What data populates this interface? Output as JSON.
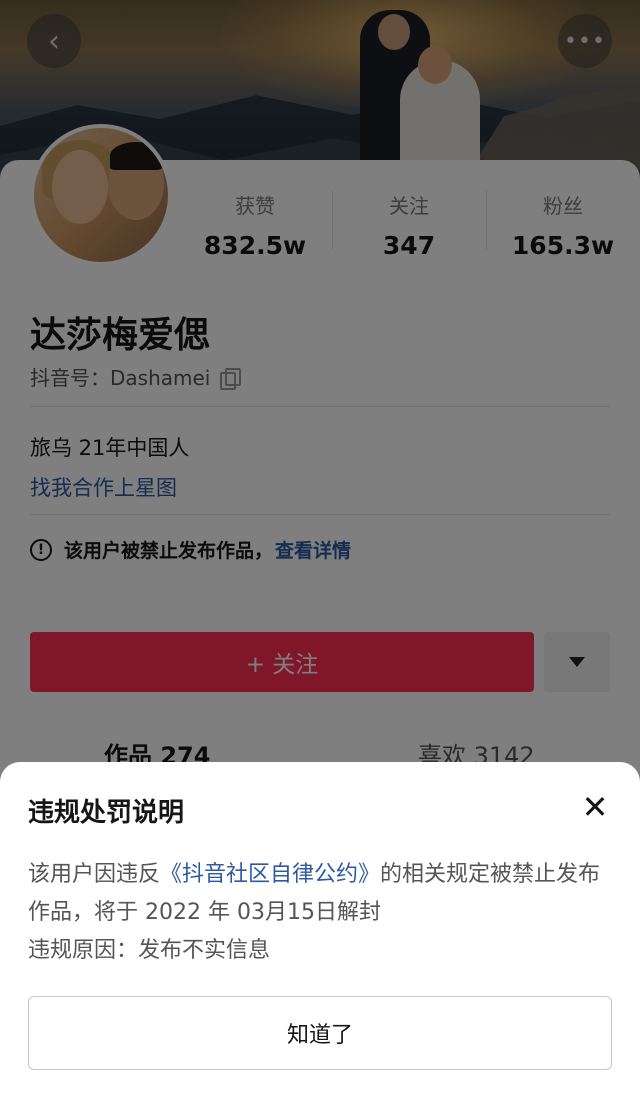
{
  "header": {
    "back_icon": "back-arrow-icon",
    "more_icon": "more-dots-icon"
  },
  "profile": {
    "stats": [
      {
        "label": "获赞",
        "value": "832.5w"
      },
      {
        "label": "关注",
        "value": "347"
      },
      {
        "label": "粉丝",
        "value": "165.3w"
      }
    ],
    "name": "达莎梅爱偲",
    "douyin_id": "抖音号：Dashamei",
    "bio_line1": "旅乌 21年中国人",
    "bio_link": "找我合作上星图",
    "notice_text": "该用户被禁止发布作品，",
    "notice_link": "查看详情",
    "follow_label": "+ 关注",
    "tabs": {
      "works": "作品 274",
      "likes": "喜欢 3142"
    },
    "colors": {
      "follow_button": "#fe2c55",
      "link": "#2d5aa3"
    }
  },
  "sheet": {
    "title": "违规处罚说明",
    "body_prefix": "该用户因违反",
    "body_link": "《抖音社区自律公约》",
    "body_suffix": "的相关规定被禁止发布作品，将于 2022 年 03月15日解封",
    "reason": "违规原因：发布不实信息",
    "confirm_label": "知道了"
  }
}
